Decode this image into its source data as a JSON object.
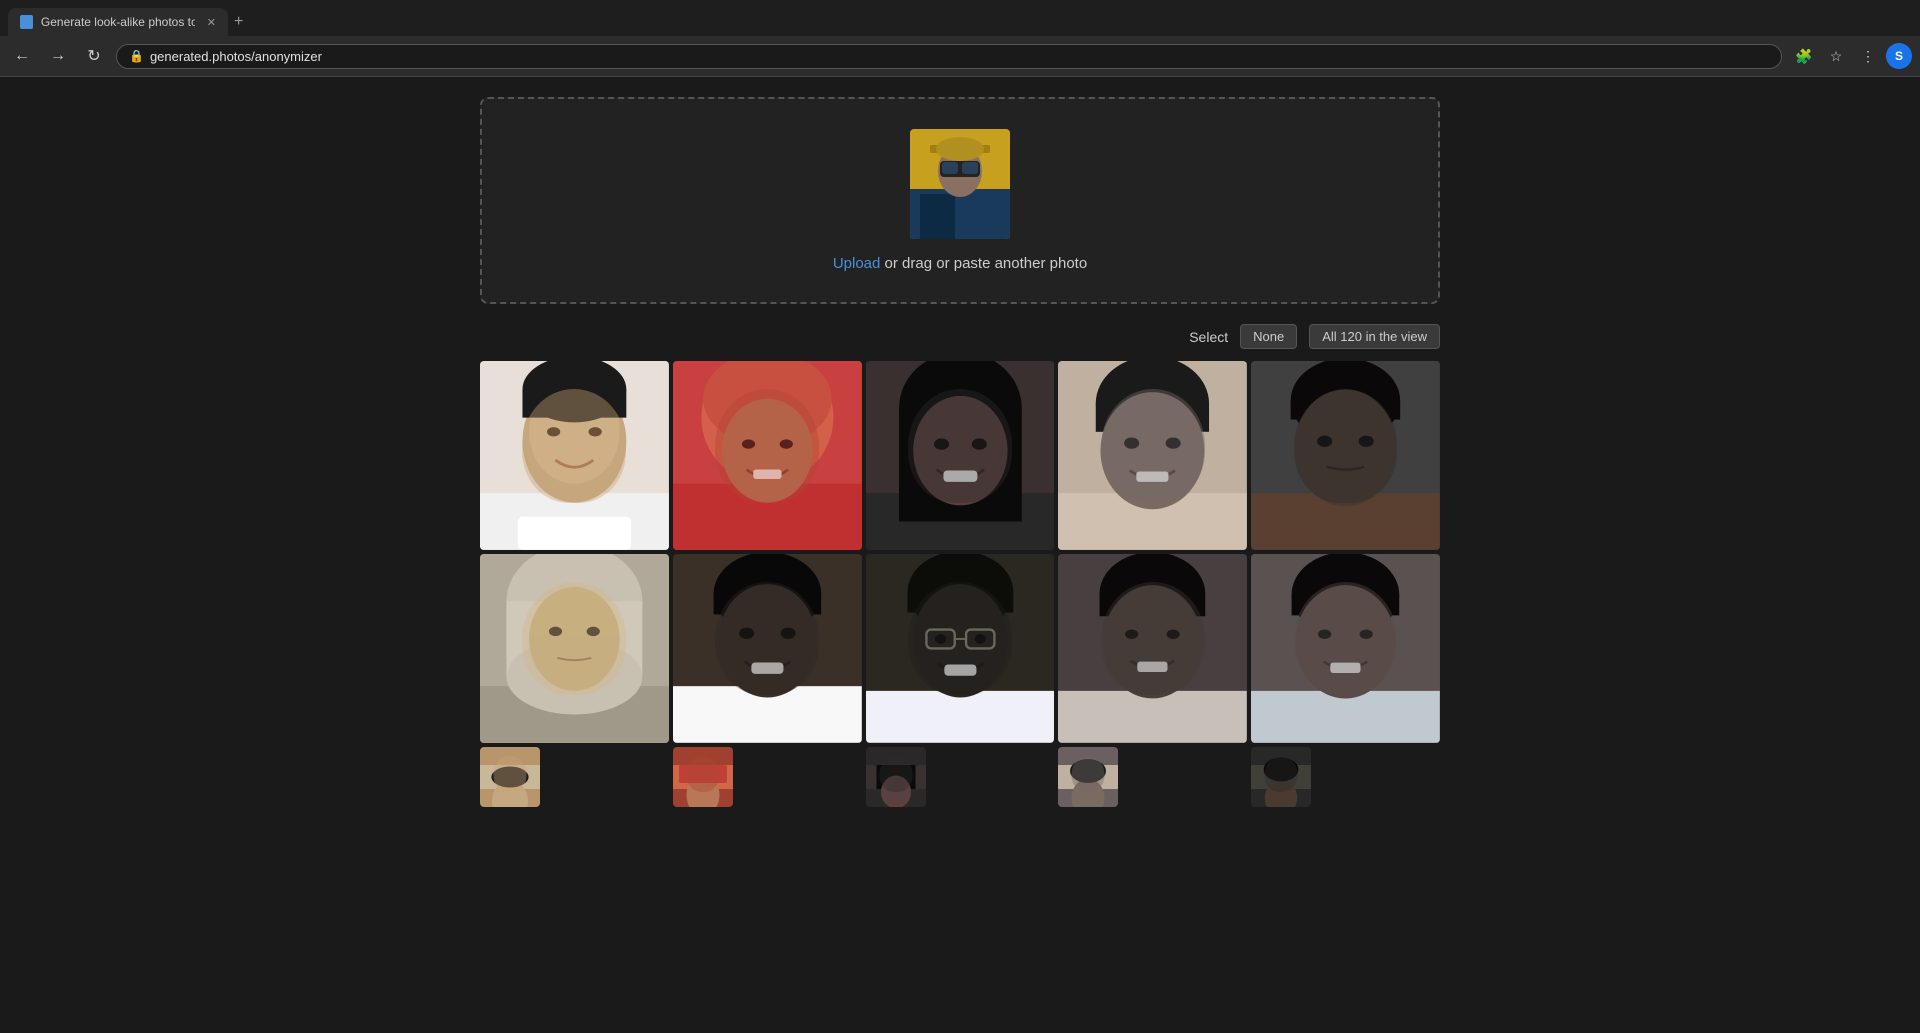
{
  "browser": {
    "tab_title": "Generate look-alike photos to p",
    "url": "generated.photos/anonymizer",
    "new_tab_label": "+"
  },
  "upload_section": {
    "link_text": "Upload",
    "instruction_text": " or drag or paste another photo"
  },
  "controls": {
    "select_label": "Select",
    "none_button": "None",
    "all_button": "All 120 in the view"
  },
  "photos": [
    {
      "id": 1,
      "style": "face-1",
      "description": "Young girl, light brown skin, smiling, white top"
    },
    {
      "id": 2,
      "style": "face-2",
      "description": "Woman with pink/red head covering, warm skin, smiling"
    },
    {
      "id": 3,
      "style": "face-3",
      "description": "Young woman, dark skin, long dark hair, smiling"
    },
    {
      "id": 4,
      "style": "face-4",
      "description": "Man, dark skin, short hair, smiling, light shirt"
    },
    {
      "id": 5,
      "style": "face-5",
      "description": "Man, dark skin, short hair, neutral expression, brown top"
    },
    {
      "id": 6,
      "style": "face-6",
      "description": "Older woman, tan skin, head covering, neutral expression"
    },
    {
      "id": 7,
      "style": "face-7",
      "description": "Woman, dark skin, short hair, smiling, white top"
    },
    {
      "id": 8,
      "style": "face-8",
      "description": "Woman, dark skin, glasses, smiling"
    },
    {
      "id": 9,
      "style": "face-9",
      "description": "Woman, dark skin, short hair, smiling"
    },
    {
      "id": 10,
      "style": "face-10",
      "description": "Woman, dark skin, short hair, light top, smiling"
    },
    {
      "id": 11,
      "style": "face-1",
      "description": "Person row 3 col 1"
    },
    {
      "id": 12,
      "style": "face-2",
      "description": "Person row 3 col 2"
    },
    {
      "id": 13,
      "style": "face-3",
      "description": "Person row 3 col 3"
    },
    {
      "id": 14,
      "style": "face-4",
      "description": "Person row 3 col 4"
    },
    {
      "id": 15,
      "style": "face-5",
      "description": "Person row 3 col 5"
    }
  ],
  "face_colors": {
    "face_1_bg": "#b8956a",
    "face_2_bg": "#c06040",
    "face_3_bg": "#3a3030",
    "face_4_bg": "#6a6060",
    "face_5_bg": "#504848",
    "face_6_bg": "#c8b8a0",
    "face_7_bg": "#3a3430",
    "face_8_bg": "#2c2820",
    "face_9_bg": "#4a4440",
    "face_10_bg": "#5a5250"
  }
}
